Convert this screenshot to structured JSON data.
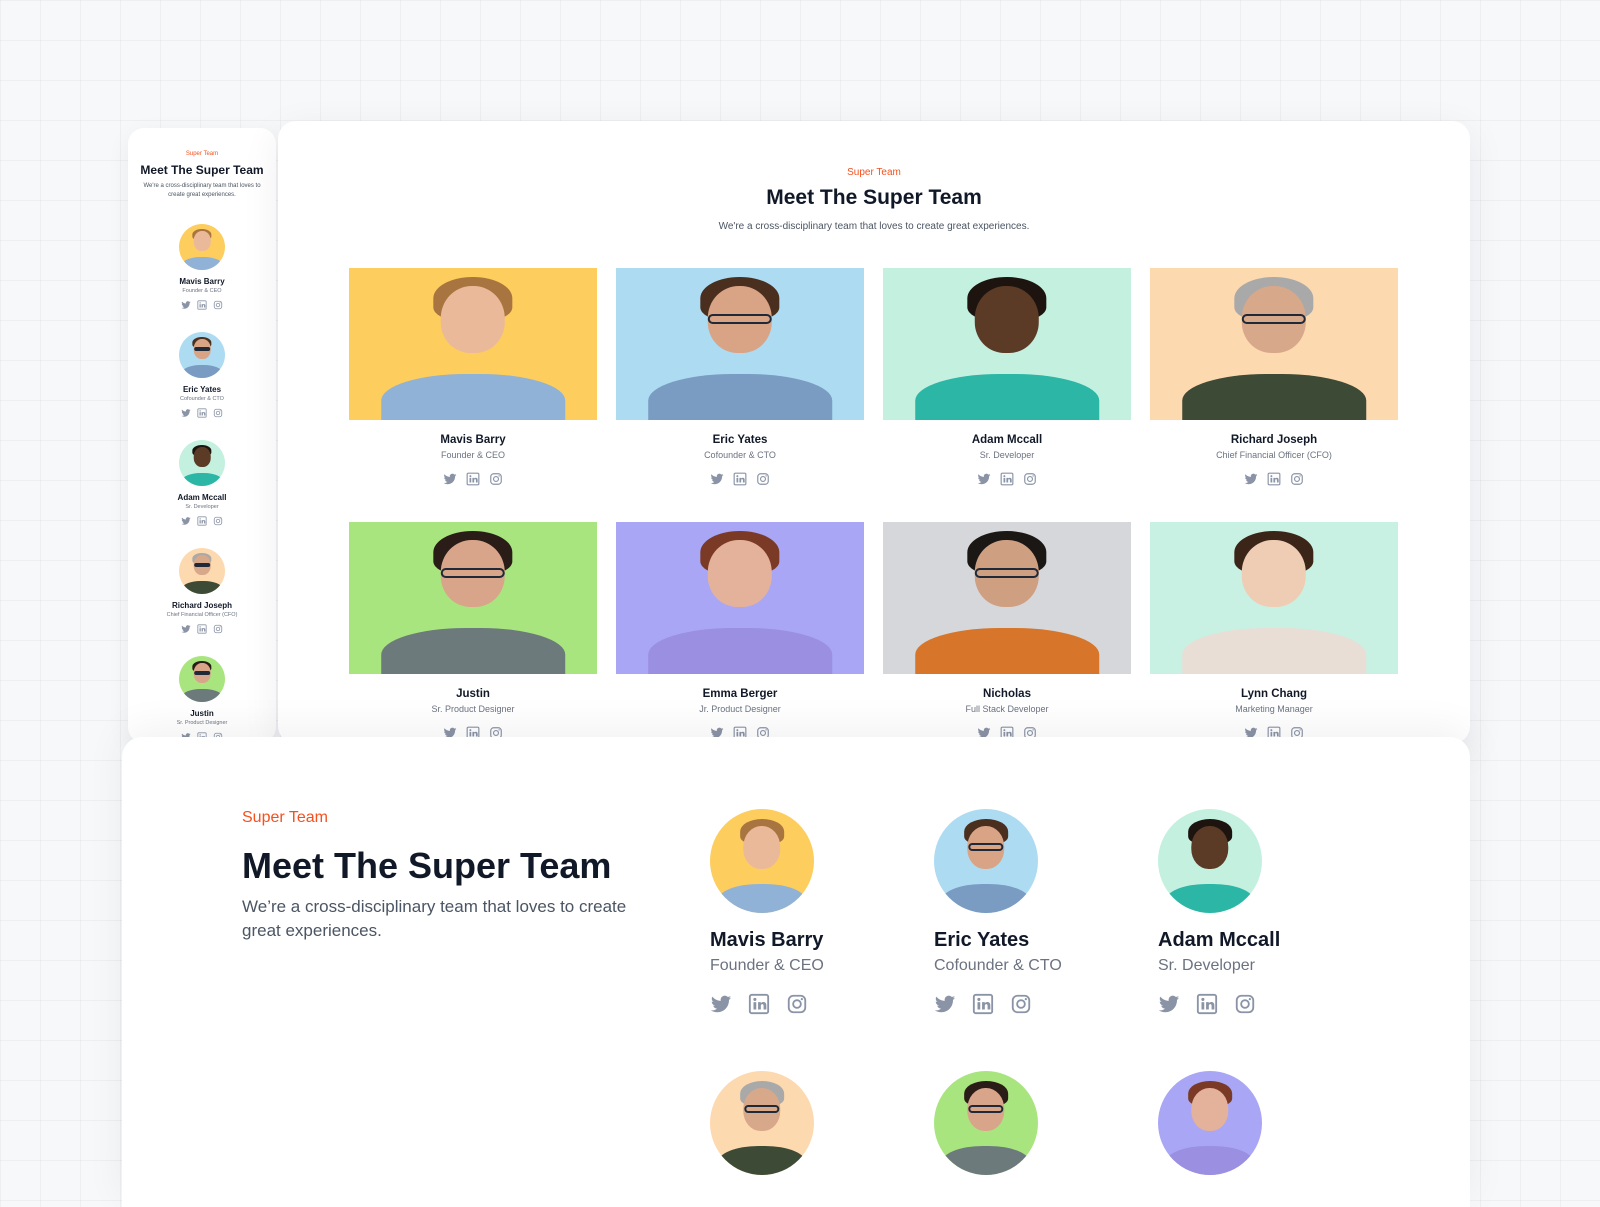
{
  "heading": {
    "eyebrow": "Super Team",
    "title": "Meet The Super Team",
    "subtitle": "We're a cross-disciplinary team that loves to create great experiences.",
    "subtitle_bottom": "We’re a cross-disciplinary team that loves to create great experiences."
  },
  "icons": [
    "twitter-icon",
    "linkedin-icon",
    "instagram-icon"
  ],
  "colors": {
    "accent": "#f4511e",
    "icon": "#8a94a6",
    "text": "#111827"
  },
  "members": [
    {
      "name": "Mavis Barry",
      "role": "Founder & CEO",
      "bg": "#fdcd5e",
      "skin": "#e9b99a",
      "hair": "#a8743f",
      "shirt": "#8fb2d6",
      "glasses": false
    },
    {
      "name": "Eric Yates",
      "role": "Cofounder & CTO",
      "bg": "#addcf2",
      "skin": "#d9a386",
      "hair": "#4a2e1e",
      "shirt": "#7a9bc2",
      "glasses": true
    },
    {
      "name": "Adam Mccall",
      "role": "Sr. Developer",
      "bg": "#c4f0e0",
      "skin": "#5b3a26",
      "hair": "#1d1410",
      "shirt": "#2bb6a6",
      "glasses": false
    },
    {
      "name": "Richard Joseph",
      "role": "Chief Financial Officer (CFO)",
      "bg": "#fdd9b0",
      "skin": "#d8a88a",
      "hair": "#a9a9a9",
      "shirt": "#3d4a36",
      "glasses": true
    },
    {
      "name": "Justin",
      "role": "Sr. Product Designer",
      "bg": "#a9e57f",
      "skin": "#d8a58a",
      "hair": "#2a1c16",
      "shirt": "#6c7a7c",
      "glasses": true
    },
    {
      "name": "Emma Berger",
      "role": "Jr. Product Designer",
      "bg": "#a9a6f5",
      "skin": "#e4b29a",
      "hair": "#7a3a26",
      "shirt": "#9a8fe0",
      "glasses": false
    },
    {
      "name": "Nicholas",
      "role": "Full Stack Developer",
      "bg": "#d6d7db",
      "skin": "#cf9f82",
      "hair": "#1b1715",
      "shirt": "#d7762a",
      "glasses": true
    },
    {
      "name": "Lynn Chang",
      "role": "Marketing Manager",
      "bg": "#c9f1e3",
      "skin": "#efcdb5",
      "hair": "#3b2519",
      "shirt": "#e8ded6",
      "glasses": false
    }
  ],
  "views": {
    "mobile_count": 5,
    "desktop_count": 8,
    "bottom_count": 6,
    "bottom_details_count": 3
  }
}
